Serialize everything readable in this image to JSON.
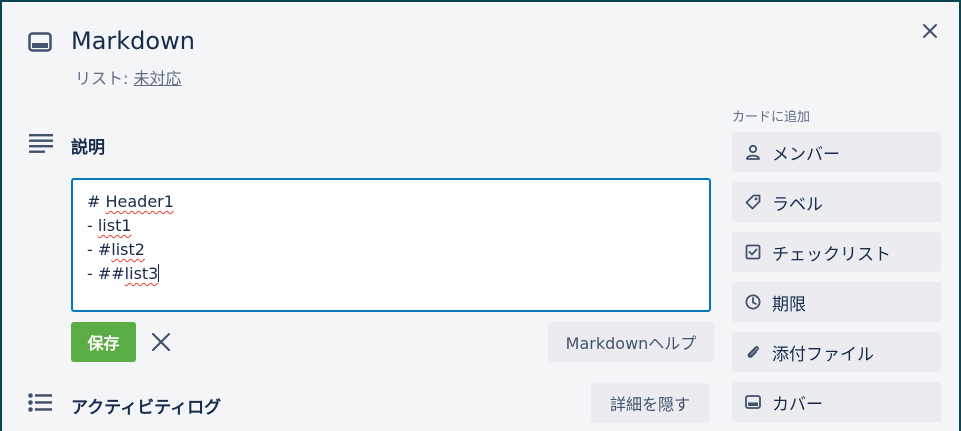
{
  "card": {
    "title": "Markdown",
    "list_prefix": "リスト: ",
    "list_name": "未対応"
  },
  "description": {
    "heading": "説明",
    "lines": [
      {
        "prefix": "# ",
        "word": "Header1"
      },
      {
        "prefix": "- ",
        "word": "list1"
      },
      {
        "prefix": "- #",
        "word": "list2"
      },
      {
        "prefix": "- ##",
        "word": "list3"
      }
    ],
    "save_label": "保存",
    "help_label": "Markdownヘルプ"
  },
  "activity": {
    "heading": "アクティビティログ",
    "hide_details_label": "詳細を隠す"
  },
  "sidebar": {
    "label": "カードに追加",
    "items": [
      {
        "label": "メンバー",
        "icon": "person-icon"
      },
      {
        "label": "ラベル",
        "icon": "tag-icon"
      },
      {
        "label": "チェックリスト",
        "icon": "checkbox-icon"
      },
      {
        "label": "期限",
        "icon": "clock-icon"
      },
      {
        "label": "添付ファイル",
        "icon": "paperclip-icon"
      },
      {
        "label": "カバー",
        "icon": "cover-icon"
      }
    ]
  },
  "colors": {
    "save": "#5aac44",
    "editor_border": "#0079bf",
    "frame": "#0b4650"
  }
}
